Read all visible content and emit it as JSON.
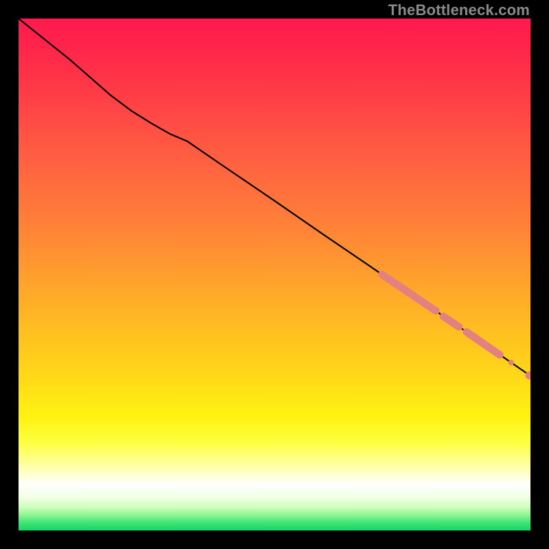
{
  "attribution": "TheBottleneck.com",
  "colors": {
    "gradient_stops": [
      {
        "offset": 0.0,
        "color": "#ff1a4d"
      },
      {
        "offset": 0.05,
        "color": "#ff234b"
      },
      {
        "offset": 0.12,
        "color": "#ff3547"
      },
      {
        "offset": 0.2,
        "color": "#ff4b45"
      },
      {
        "offset": 0.3,
        "color": "#ff6640"
      },
      {
        "offset": 0.4,
        "color": "#ff8038"
      },
      {
        "offset": 0.5,
        "color": "#ff9e2e"
      },
      {
        "offset": 0.6,
        "color": "#ffbc22"
      },
      {
        "offset": 0.7,
        "color": "#ffd818"
      },
      {
        "offset": 0.78,
        "color": "#fff312"
      },
      {
        "offset": 0.83,
        "color": "#fdff43"
      },
      {
        "offset": 0.88,
        "color": "#feffb5"
      },
      {
        "offset": 0.91,
        "color": "#ffffff"
      },
      {
        "offset": 0.935,
        "color": "#f2ffe5"
      },
      {
        "offset": 0.955,
        "color": "#ccffbb"
      },
      {
        "offset": 0.97,
        "color": "#8df592"
      },
      {
        "offset": 0.985,
        "color": "#3ee477"
      },
      {
        "offset": 1.0,
        "color": "#17d665"
      }
    ],
    "line": "#000000",
    "marker": "#e38080"
  },
  "chart_data": {
    "type": "line",
    "title": "",
    "xlabel": "",
    "ylabel": "",
    "xlim": [
      0,
      100
    ],
    "ylim": [
      0,
      100
    ],
    "grid": false,
    "legend": false,
    "series": [
      {
        "name": "curve",
        "x": [
          0,
          5,
          10,
          14,
          18,
          22,
          26,
          29.5,
          33,
          40,
          50,
          60,
          70,
          80,
          90,
          100
        ],
        "y": [
          100,
          96,
          92,
          88.5,
          85,
          82,
          79.5,
          77.5,
          76,
          71.2,
          64.4,
          57.5,
          50.7,
          43.9,
          37.1,
          30.2
        ]
      }
    ],
    "marker_segments": [
      {
        "x0": 71.0,
        "y0": 50.0,
        "x1": 81.5,
        "y1": 42.9
      },
      {
        "x0": 83.0,
        "y0": 41.8,
        "x1": 86.0,
        "y1": 39.8
      },
      {
        "x0": 87.5,
        "y0": 38.8,
        "x1": 94.0,
        "y1": 34.3
      }
    ],
    "marker_points": [
      {
        "x": 96.2,
        "y": 32.8,
        "r": 0.55
      },
      {
        "x": 99.8,
        "y": 30.3,
        "r": 0.8
      }
    ]
  }
}
